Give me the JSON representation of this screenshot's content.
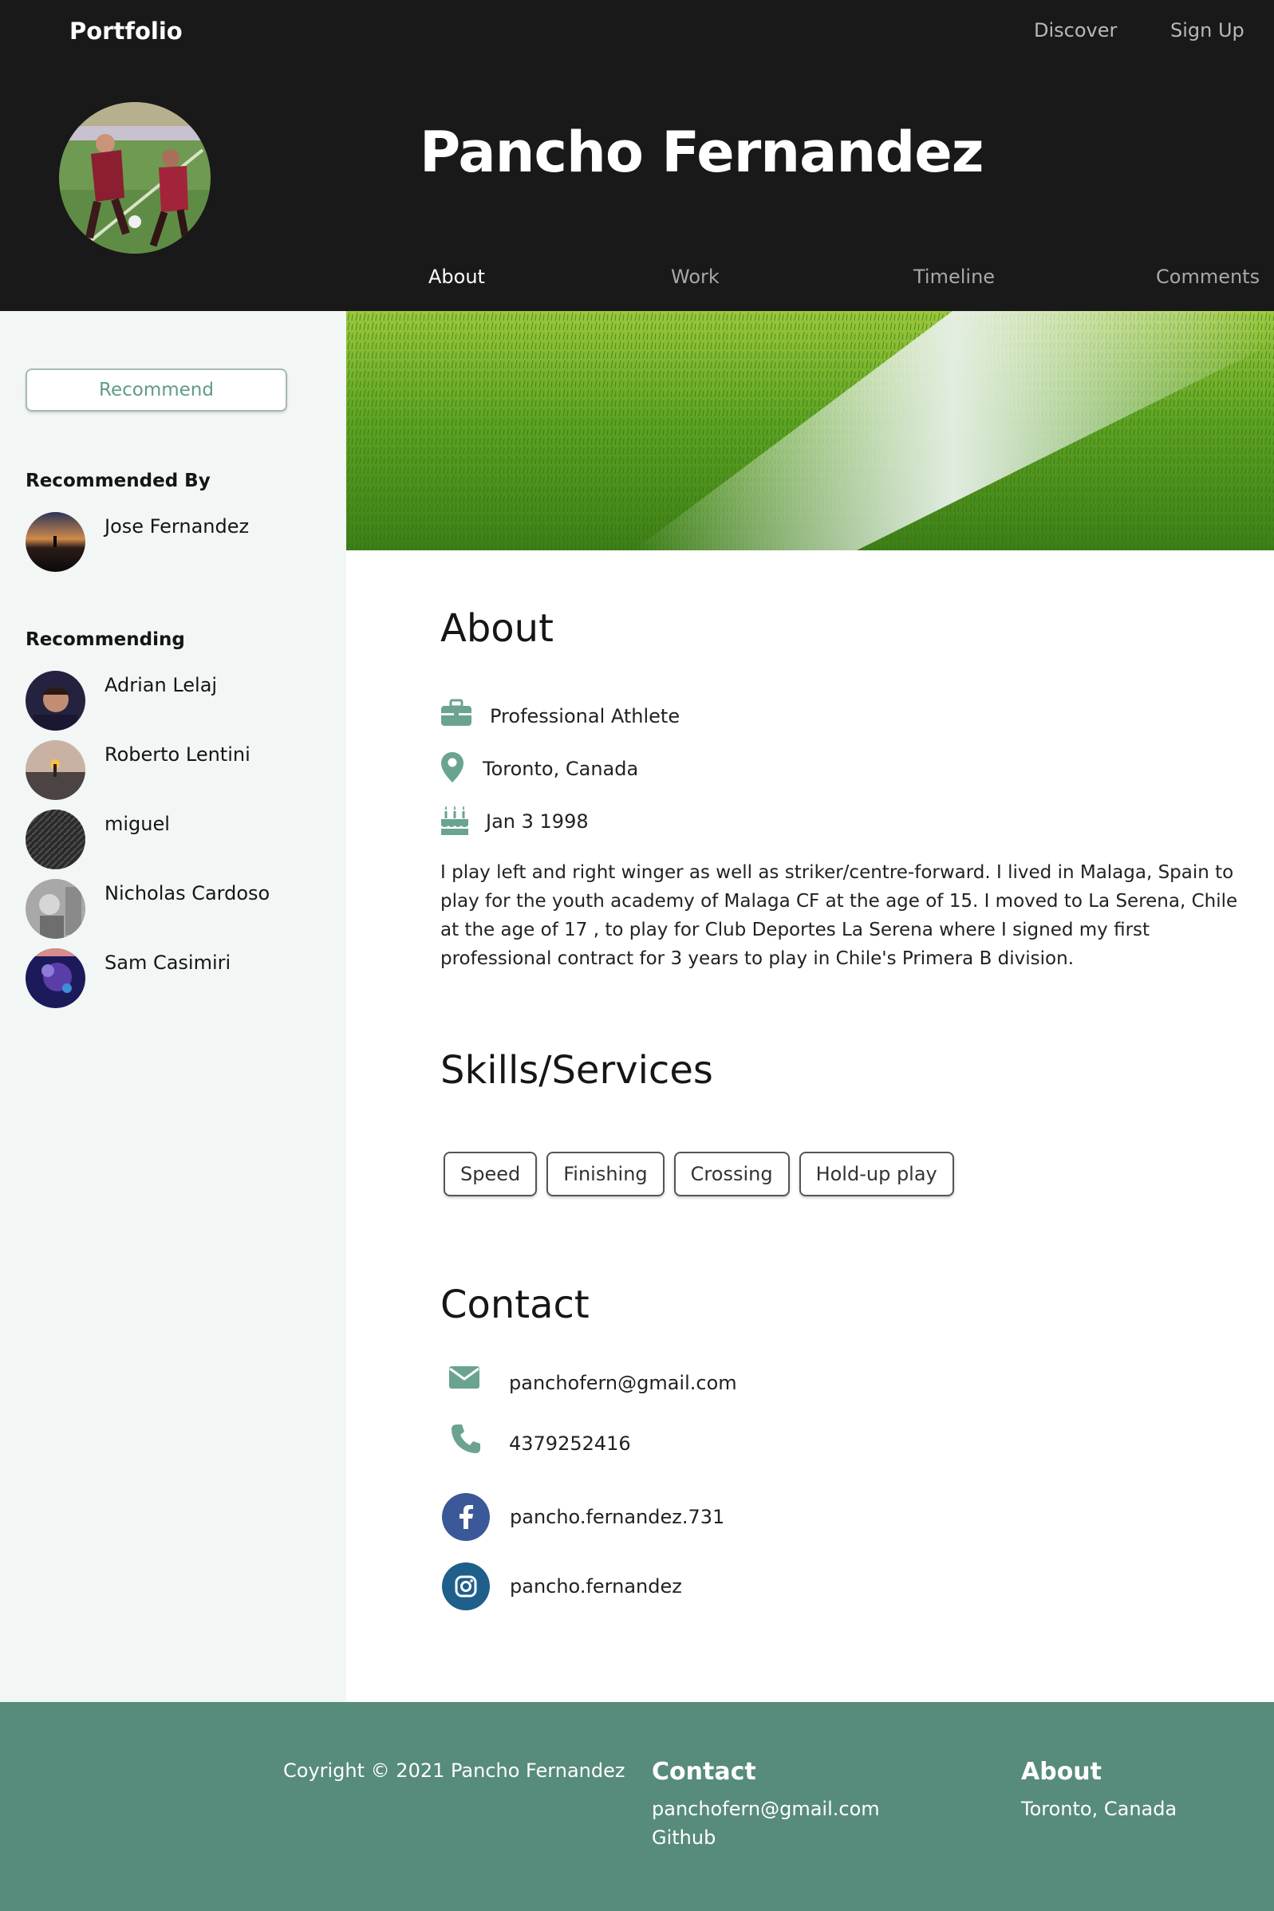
{
  "header": {
    "brand": "Portfolio",
    "nav": [
      {
        "label": "Discover"
      },
      {
        "label": "Sign Up"
      }
    ],
    "profile_name": "Pancho Fernandez",
    "tabs": [
      {
        "label": "About",
        "active": true
      },
      {
        "label": "Work",
        "active": false
      },
      {
        "label": "Timeline",
        "active": false
      },
      {
        "label": "Comments",
        "active": false
      }
    ]
  },
  "sidebar": {
    "recommend_label": "Recommend",
    "recommended_by_title": "Recommended By",
    "recommended_by": [
      {
        "name": "Jose Fernandez"
      }
    ],
    "recommending_title": "Recommending",
    "recommending": [
      {
        "name": "Adrian Lelaj"
      },
      {
        "name": "Roberto Lentini"
      },
      {
        "name": "miguel"
      },
      {
        "name": "Nicholas Cardoso"
      },
      {
        "name": "Sam Casimiri"
      }
    ]
  },
  "about": {
    "title": "About",
    "occupation": "Professional Athlete",
    "location": "Toronto, Canada",
    "birthday": "Jan 3 1998",
    "bio": "I play left and right winger as well as striker/centre-forward. I lived in Malaga, Spain to play for the youth academy of Malaga CF at the age of 15. I moved to La Serena, Chile at the age of 17 , to play for Club Deportes La Serena where I signed my first professional contract for 3 years to play in Chile's Primera B division."
  },
  "skills": {
    "title": "Skills/Services",
    "items": [
      "Speed",
      "Finishing",
      "Crossing",
      "Hold-up play"
    ]
  },
  "contact": {
    "title": "Contact",
    "email": "panchofern@gmail.com",
    "phone": "4379252416",
    "facebook": "pancho.fernandez.731",
    "instagram": "pancho.fernandez"
  },
  "footer": {
    "copyright": "Coyright © 2021 Pancho Fernandez",
    "contact_title": "Contact",
    "contact_email": "panchofern@gmail.com",
    "contact_github": "Github",
    "about_title": "About",
    "about_location": "Toronto, Canada"
  },
  "colors": {
    "header_bg": "#191919",
    "accent": "#6aa391",
    "sidebar_bg": "#f2f7f5",
    "footer_bg": "#578b7b",
    "facebook": "#3b5998",
    "instagram": "#1f5f8b"
  },
  "icons": [
    "briefcase-icon",
    "map-pin-icon",
    "birthday-cake-icon",
    "envelope-icon",
    "phone-icon",
    "facebook-icon",
    "instagram-icon"
  ]
}
